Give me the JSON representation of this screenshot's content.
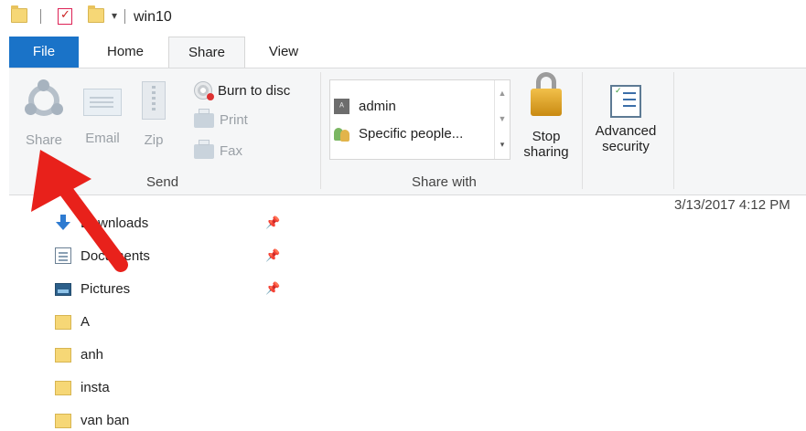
{
  "title_bar": {
    "title": "win10"
  },
  "tabs": [
    {
      "label": "File"
    },
    {
      "label": "Home"
    },
    {
      "label": "Share"
    },
    {
      "label": "View"
    }
  ],
  "ribbon": {
    "send_group": {
      "label": "Send",
      "share": "Share",
      "email": "Email",
      "zip": "Zip",
      "burn": "Burn to disc",
      "print": "Print",
      "fax": "Fax"
    },
    "share_with_group": {
      "label": "Share with",
      "items": [
        {
          "label": "admin",
          "icon": "user-icon"
        },
        {
          "label": "Specific people...",
          "icon": "people-icon"
        }
      ],
      "stop_sharing_line1": "Stop",
      "stop_sharing_line2": "sharing"
    },
    "advanced_security_line1": "Advanced",
    "advanced_security_line2": "security"
  },
  "nav": [
    {
      "label": "Downloads",
      "icon": "download-icon",
      "pinned": true
    },
    {
      "label": "Documents",
      "icon": "documents-icon",
      "pinned": true
    },
    {
      "label": "Pictures",
      "icon": "pictures-icon",
      "pinned": true
    },
    {
      "label": "A",
      "icon": "folder-icon",
      "pinned": false
    },
    {
      "label": "anh",
      "icon": "folder-icon",
      "pinned": false
    },
    {
      "label": "insta",
      "icon": "folder-icon",
      "pinned": false
    },
    {
      "label": "van ban",
      "icon": "folder-icon",
      "pinned": false
    }
  ],
  "content": {
    "modified": "3/13/2017 4:12 PM"
  },
  "annotation": {
    "color": "#e8211b",
    "points_to": "share-button"
  },
  "colors": {
    "file_tab": "#1a73c8",
    "ribbon_bg": "#f5f6f7"
  }
}
